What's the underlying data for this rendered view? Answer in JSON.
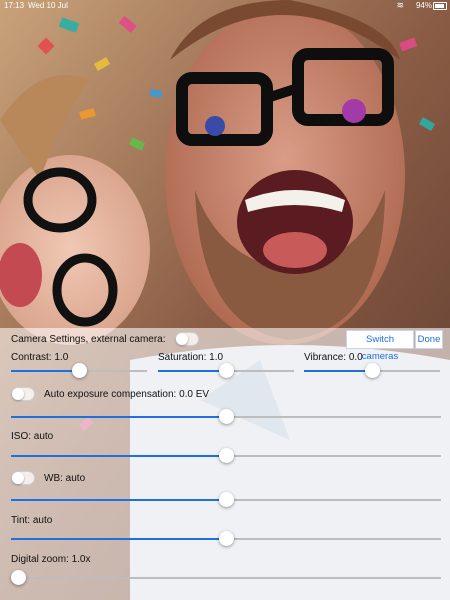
{
  "status_bar": {
    "time": "17:13",
    "date": "Wed 10 Jul",
    "battery": "94%"
  },
  "header": {
    "title": "Camera Settings, external camera:",
    "external_camera_enabled": false,
    "switch_cameras_label": "Switch cameras",
    "done_label": "Done"
  },
  "sliders": {
    "contrast": {
      "label": "Contrast: 1.0",
      "fraction": 0.5
    },
    "saturation": {
      "label": "Saturation: 1.0",
      "fraction": 0.5
    },
    "vibrance": {
      "label": "Vibrance: 0.0",
      "fraction": 0.5
    },
    "exposure": {
      "toggle_on": false,
      "label": "Auto exposure compensation: 0.0 EV",
      "fraction": 0.5
    },
    "iso": {
      "label": "ISO: auto",
      "fraction": 0.5
    },
    "wb": {
      "toggle_on": false,
      "label": "WB: auto",
      "fraction": 0.5
    },
    "tint": {
      "label": "Tint: auto",
      "fraction": 0.5
    },
    "zoom": {
      "label": "Digital zoom: 1.0x",
      "fraction": 0.0
    }
  },
  "colors": {
    "accent": "#1f6fe0",
    "track": "#bdbdbd"
  }
}
